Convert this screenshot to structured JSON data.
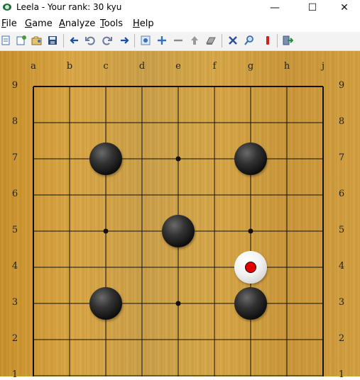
{
  "window": {
    "title": "Leela - Your rank: 30 kyu",
    "minimize_glyph": "—",
    "maximize_glyph": "☐",
    "close_glyph": "✕"
  },
  "menu": [
    {
      "label": "File",
      "key": "F",
      "rest": "ile"
    },
    {
      "label": "Game",
      "key": "G",
      "rest": "ame"
    },
    {
      "label": "Analyze",
      "key": "A",
      "rest": "nalyze"
    },
    {
      "label": "Tools",
      "key": "T",
      "rest": "ools"
    },
    {
      "label": "Help",
      "key": "H",
      "rest": "elp"
    }
  ],
  "toolbar": {
    "icons": [
      "open-icon",
      "new-game-icon",
      "load-icon",
      "save-icon",
      "back-icon",
      "undo-icon",
      "redo-icon",
      "forward-icon",
      "settings-icon",
      "zoom-in-icon",
      "zoom-out-icon",
      "up-icon",
      "eraser-icon",
      "cancel-icon",
      "search-icon",
      "flag-icon",
      "exit-icon"
    ]
  },
  "board": {
    "size": 9,
    "column_labels": [
      "a",
      "b",
      "c",
      "d",
      "e",
      "f",
      "g",
      "h",
      "j"
    ],
    "row_labels": [
      "9",
      "8",
      "7",
      "6",
      "5",
      "4",
      "3",
      "2",
      "1"
    ],
    "star_points": [
      "c5",
      "e7",
      "e5",
      "e3",
      "g5"
    ],
    "stones": [
      {
        "point": "c7",
        "color": "black"
      },
      {
        "point": "g7",
        "color": "black"
      },
      {
        "point": "e5",
        "color": "black"
      },
      {
        "point": "g4",
        "color": "white",
        "last_move": true
      },
      {
        "point": "c3",
        "color": "black"
      },
      {
        "point": "g3",
        "color": "black"
      }
    ],
    "colors": {
      "line": "#111111",
      "last_move_marker": "#e00000"
    }
  }
}
